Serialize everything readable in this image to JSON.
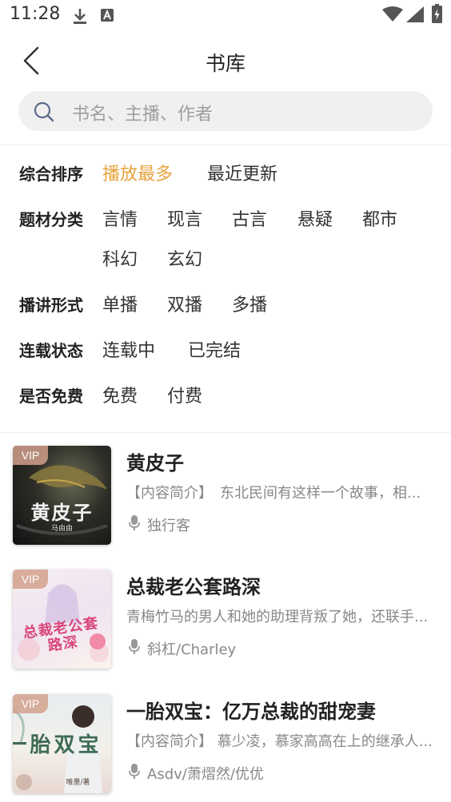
{
  "status_bar": {
    "time": "11:28"
  },
  "header": {
    "title": "书库",
    "back_icon": "chevron-left-icon"
  },
  "search": {
    "placeholder": "书名、主播、作者"
  },
  "filters": [
    {
      "label": "综合排序",
      "options": [
        "播放最多",
        "最近更新"
      ],
      "selected": "播放最多"
    },
    {
      "label": "题材分类",
      "options": [
        "言情",
        "现言",
        "古言",
        "悬疑",
        "都市",
        "科幻",
        "玄幻"
      ]
    },
    {
      "label": "播讲形式",
      "options": [
        "单播",
        "双播",
        "多播"
      ]
    },
    {
      "label": "连载状态",
      "options": [
        "连载中",
        "已完结"
      ]
    },
    {
      "label": "是否免费",
      "options": [
        "免费",
        "付费"
      ]
    }
  ],
  "colors": {
    "accent": "#e8a33d",
    "search_bg": "#f0f0f0",
    "secondary_text": "#888888"
  },
  "books": [
    {
      "badge": "VIP",
      "title": "黄皮子",
      "description": "【内容简介】　东北民间有这样一个故事，相...",
      "narrator": "独行客",
      "cover_text": "黄皮子",
      "cover_author": "马由由"
    },
    {
      "badge": "VIP",
      "title": "总裁老公套路深",
      "description": "青梅竹马的男人和她的助理背叛了她，还联手...",
      "narrator": "斜杠/Charley",
      "cover_text": "总裁老公套路深"
    },
    {
      "badge": "VIP",
      "title": "一胎双宝：亿万总裁的甜宠妻",
      "description": "【内容简介】 慕少凌，慕家高高在上的继承人...",
      "narrator": "Asdv/萧熠然/优优",
      "cover_text": "一胎双宝",
      "cover_author": "唯墨/著"
    }
  ]
}
